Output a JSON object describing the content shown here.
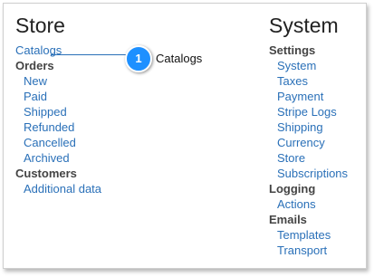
{
  "store": {
    "title": "Store",
    "catalogs": "Catalogs",
    "orders_heading": "Orders",
    "orders": [
      "New",
      "Paid",
      "Shipped",
      "Refunded",
      "Cancelled",
      "Archived"
    ],
    "customers_heading": "Customers",
    "customers": [
      "Additional data"
    ]
  },
  "system": {
    "title": "System",
    "settings_heading": "Settings",
    "settings": [
      "System",
      "Taxes",
      "Payment",
      "Stripe Logs",
      "Shipping",
      "Currency",
      "Store",
      "Subscriptions"
    ],
    "logging_heading": "Logging",
    "logging": [
      "Actions"
    ],
    "emails_heading": "Emails",
    "emails": [
      "Templates",
      "Transport"
    ]
  },
  "callout": {
    "number": "1",
    "label": "Catalogs"
  },
  "colors": {
    "link": "#2a70b8",
    "badge": "#1e90ff",
    "heading": "#444444"
  }
}
